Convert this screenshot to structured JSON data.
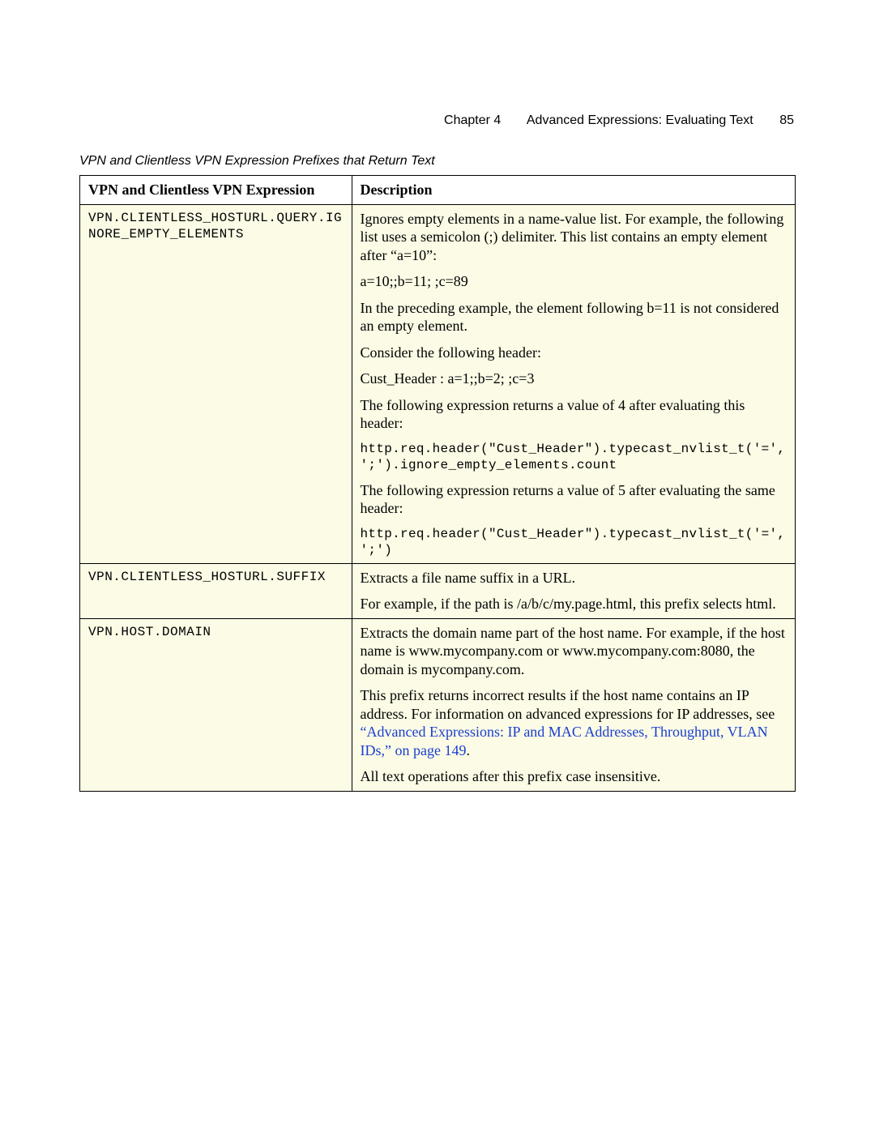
{
  "header": {
    "chapter": "Chapter 4",
    "title": "Advanced Expressions: Evaluating Text",
    "page_number": "85"
  },
  "table": {
    "caption": "VPN and Clientless VPN Expression Prefixes that Return Text",
    "columns": {
      "expression": "VPN and Clientless VPN Expression",
      "description": "Description"
    },
    "rows": [
      {
        "expression": "VPN.CLIENTLESS_HOSTURL.QUERY.IGNORE_EMPTY_ELEMENTS",
        "desc": {
          "p1": "Ignores empty elements in a name-value list. For example, the following list uses a semicolon (;) delimiter. This list contains an empty element after “a=10”:",
          "p2": "a=10;;b=11; ;c=89",
          "p3": "In the preceding example, the element following b=11 is not considered an empty element.",
          "p4": "Consider the following header:",
          "p5": "Cust_Header : a=1;;b=2; ;c=3",
          "p6": "The following expression returns a value of 4 after evaluating this header:",
          "code1": "http.req.header(\"Cust_Header\").typecast_nvlist_t('=',';').ignore_empty_elements.count",
          "p7": "The following expression returns a value of 5 after evaluating the same header:",
          "code2": "http.req.header(\"Cust_Header\").typecast_nvlist_t('=',';')"
        }
      },
      {
        "expression": "VPN.CLIENTLESS_HOSTURL.SUFFIX",
        "desc": {
          "p1": "Extracts a file name suffix in a URL.",
          "p2": "For example, if the path is /a/b/c/my.page.html, this prefix selects html."
        }
      },
      {
        "expression": "VPN.HOST.DOMAIN",
        "desc": {
          "p1": "Extracts the domain name part of the host name. For example, if the host name is www.mycompany.com or www.mycompany.com:8080, the domain is mycompany.com.",
          "p2a": "This prefix returns incorrect results if the host name contains an IP address. For information on advanced expressions for IP addresses, see ",
          "p2link": "“Advanced Expressions: IP and MAC Addresses, Throughput, VLAN IDs,” on page 149",
          "p2b": ".",
          "p3": "All text operations after this prefix case insensitive."
        }
      }
    ]
  }
}
